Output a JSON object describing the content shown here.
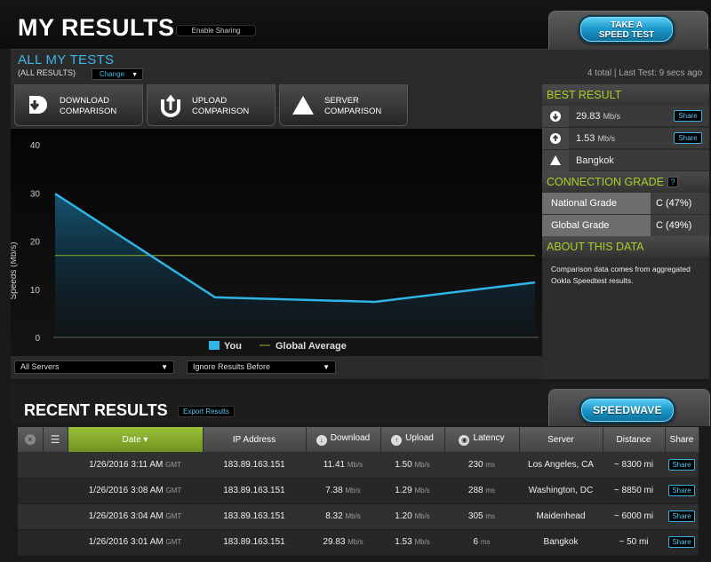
{
  "header": {
    "title": "MY RESULTS",
    "enable_sharing": "Enable Sharing",
    "take_speed_test": [
      "TAKE A",
      "SPEED TEST"
    ]
  },
  "tests": {
    "title": "ALL MY TESTS",
    "filter_label": "(ALL RESULTS)",
    "change_label": "Change",
    "meta": "4 total | Last Test: 9 secs ago"
  },
  "comparison": {
    "download": [
      "DOWNLOAD",
      "COMPARISON"
    ],
    "upload": [
      "UPLOAD",
      "COMPARISON"
    ],
    "server": [
      "SERVER",
      "COMPARISON"
    ]
  },
  "chart_data": {
    "type": "line",
    "ylabel": "Speeds (Mb/s)",
    "ylim": [
      0,
      40
    ],
    "yticks": [
      0,
      10,
      20,
      30,
      40
    ],
    "series": [
      {
        "name": "You",
        "values": [
          29.83,
          8.32,
          7.38,
          11.41
        ],
        "color": "#2fb4e6"
      },
      {
        "name": "Global Average",
        "values": [
          17,
          17,
          17,
          17
        ],
        "color": "#8fb82a"
      }
    ],
    "legend": "bottom-center",
    "grid": false
  },
  "filters": {
    "servers": "All Servers",
    "ignore_before": "Ignore Results Before"
  },
  "best_result": {
    "title": "BEST RESULT",
    "download": {
      "value": "29.83",
      "unit": "Mb/s"
    },
    "upload": {
      "value": "1.53",
      "unit": "Mb/s"
    },
    "server": "Bangkok",
    "share_label": "Share"
  },
  "connection_grade": {
    "title": "CONNECTION GRADE",
    "help": "?",
    "national_label": "National Grade",
    "national_value": "C (47%)",
    "global_label": "Global Grade",
    "global_value": "C (49%)"
  },
  "about": {
    "title": "ABOUT THIS DATA",
    "text": "Comparison data comes from aggregated Ookla Speedtest results."
  },
  "recent": {
    "title": "RECENT RESULTS",
    "export_label": "Export Results",
    "speedwave_label": "SPEEDWAVE",
    "columns": [
      "Date ▾",
      "IP Address",
      "Download",
      "Upload",
      "Latency",
      "Server",
      "Distance",
      "Share"
    ],
    "rows": [
      {
        "date": "1/26/2016 3:11 AM",
        "tz": "GMT",
        "ip": "183.89.163.151",
        "download": "11.41",
        "upload": "1.50",
        "latency": "230",
        "server": "Los Angeles, CA",
        "distance": "~ 8300 mi"
      },
      {
        "date": "1/26/2016 3:08 AM",
        "tz": "GMT",
        "ip": "183.89.163.151",
        "download": "7.38",
        "upload": "1.29",
        "latency": "288",
        "server": "Washington, DC",
        "distance": "~ 8850 mi"
      },
      {
        "date": "1/26/2016 3:04 AM",
        "tz": "GMT",
        "ip": "183.89.163.151",
        "download": "8.32",
        "upload": "1.20",
        "latency": "305",
        "server": "Maidenhead",
        "distance": "~ 6000 mi"
      },
      {
        "date": "1/26/2016 3:01 AM",
        "tz": "GMT",
        "ip": "183.89.163.151",
        "download": "29.83",
        "upload": "1.53",
        "latency": "6",
        "server": "Bangkok",
        "distance": "~ 50 mi"
      }
    ],
    "speed_unit": "Mb/s",
    "latency_unit": "ms",
    "share_label": "Share"
  }
}
